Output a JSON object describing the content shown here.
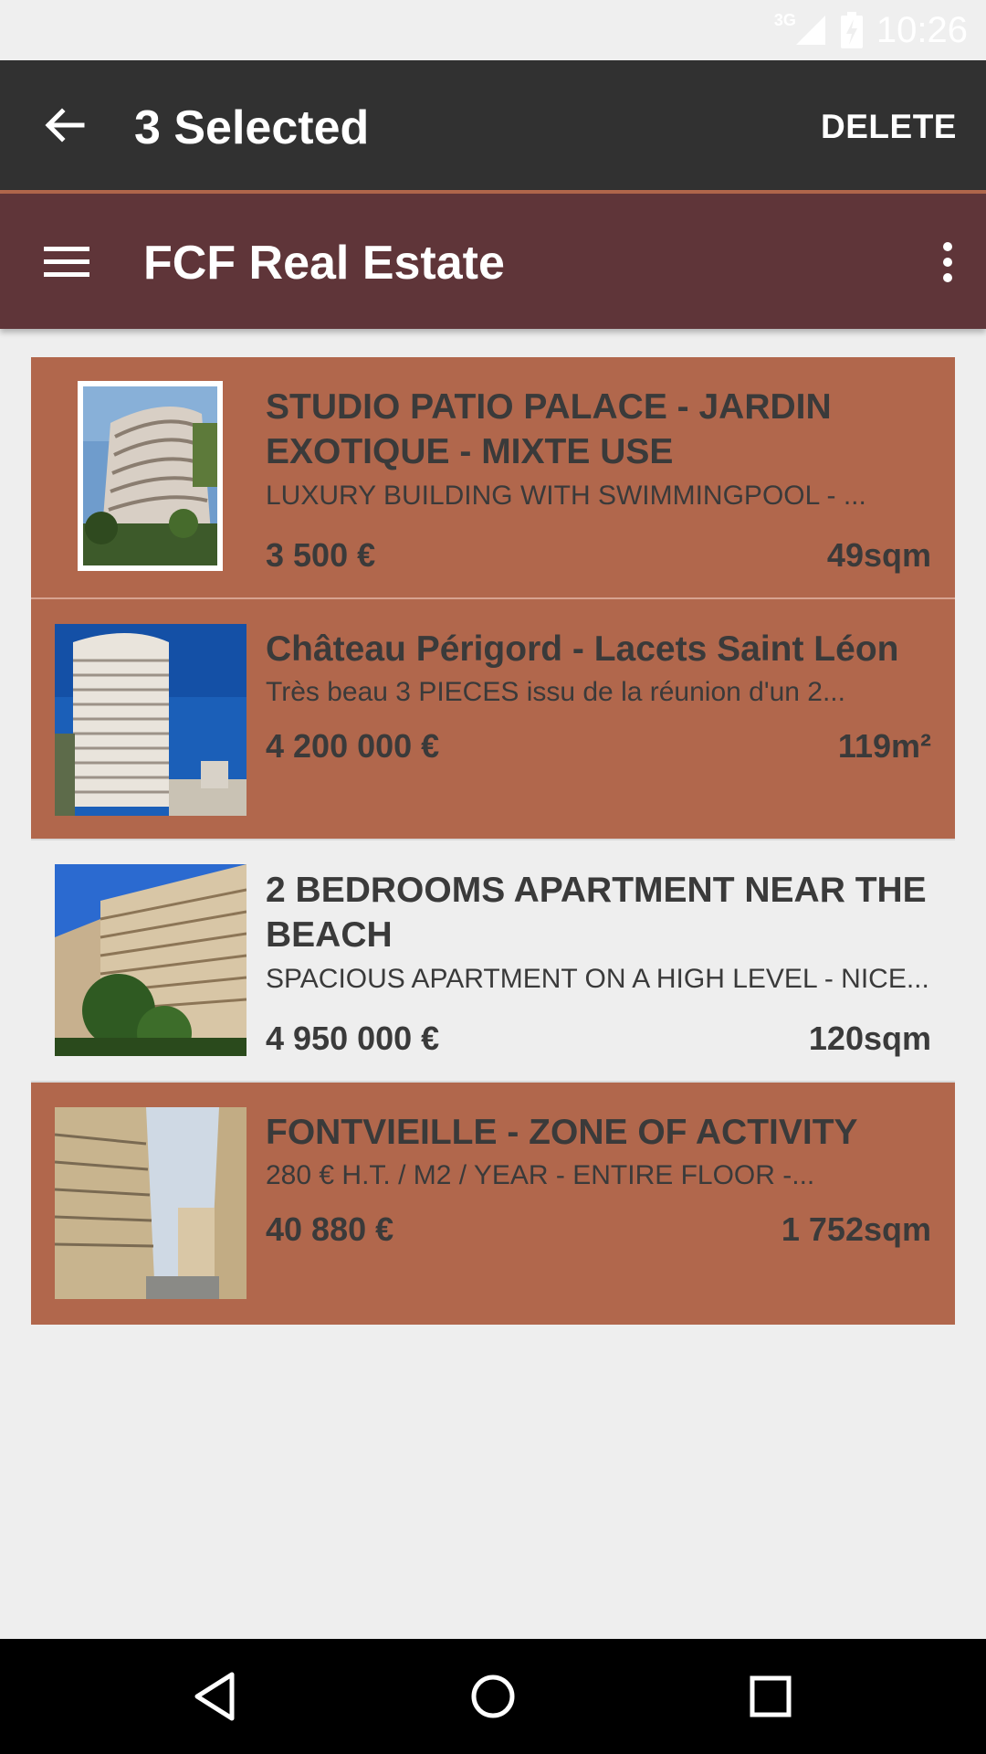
{
  "status_bar": {
    "network": "3G",
    "time": "10:26",
    "icons": [
      "signal-icon",
      "battery-icon"
    ]
  },
  "action_mode": {
    "title": "3 Selected",
    "delete_label": "DELETE",
    "background": "#313131",
    "accent": "#b1674c"
  },
  "toolbar": {
    "title": "FCF Real Estate",
    "background": "#5f3539"
  },
  "listings": [
    {
      "title": "STUDIO PATIO PALACE - JARDIN EXOTIQUE - MIXTE USE",
      "description": "LUXURY BUILDING WITH SWIMMINGPOOL - ...",
      "price": "3 500 €",
      "area": "49sqm",
      "selected": true
    },
    {
      "title": "Château Périgord - Lacets Saint Léon",
      "description": "Très beau 3 PIECES issu de la réunion d'un 2...",
      "price": "4 200 000 €",
      "area": "119m²",
      "selected": true
    },
    {
      "title": "2 BEDROOMS APARTMENT NEAR THE BEACH",
      "description": "SPACIOUS APARTMENT ON A HIGH LEVEL - NICE...",
      "price": "4 950 000 €",
      "area": "120sqm",
      "selected": false
    },
    {
      "title": "FONTVIEILLE - ZONE OF ACTIVITY",
      "description": "280 € H.T. / M2 / YEAR - ENTIRE FLOOR -...",
      "price": "40 880 €",
      "area": "1 752sqm",
      "selected": true
    }
  ],
  "colors": {
    "selected_card": "#b1674c",
    "page_background": "#eeeeee",
    "text": "#3a3a3a"
  },
  "nav_bar": {
    "buttons": [
      "back-icon",
      "home-icon",
      "recents-icon"
    ]
  }
}
